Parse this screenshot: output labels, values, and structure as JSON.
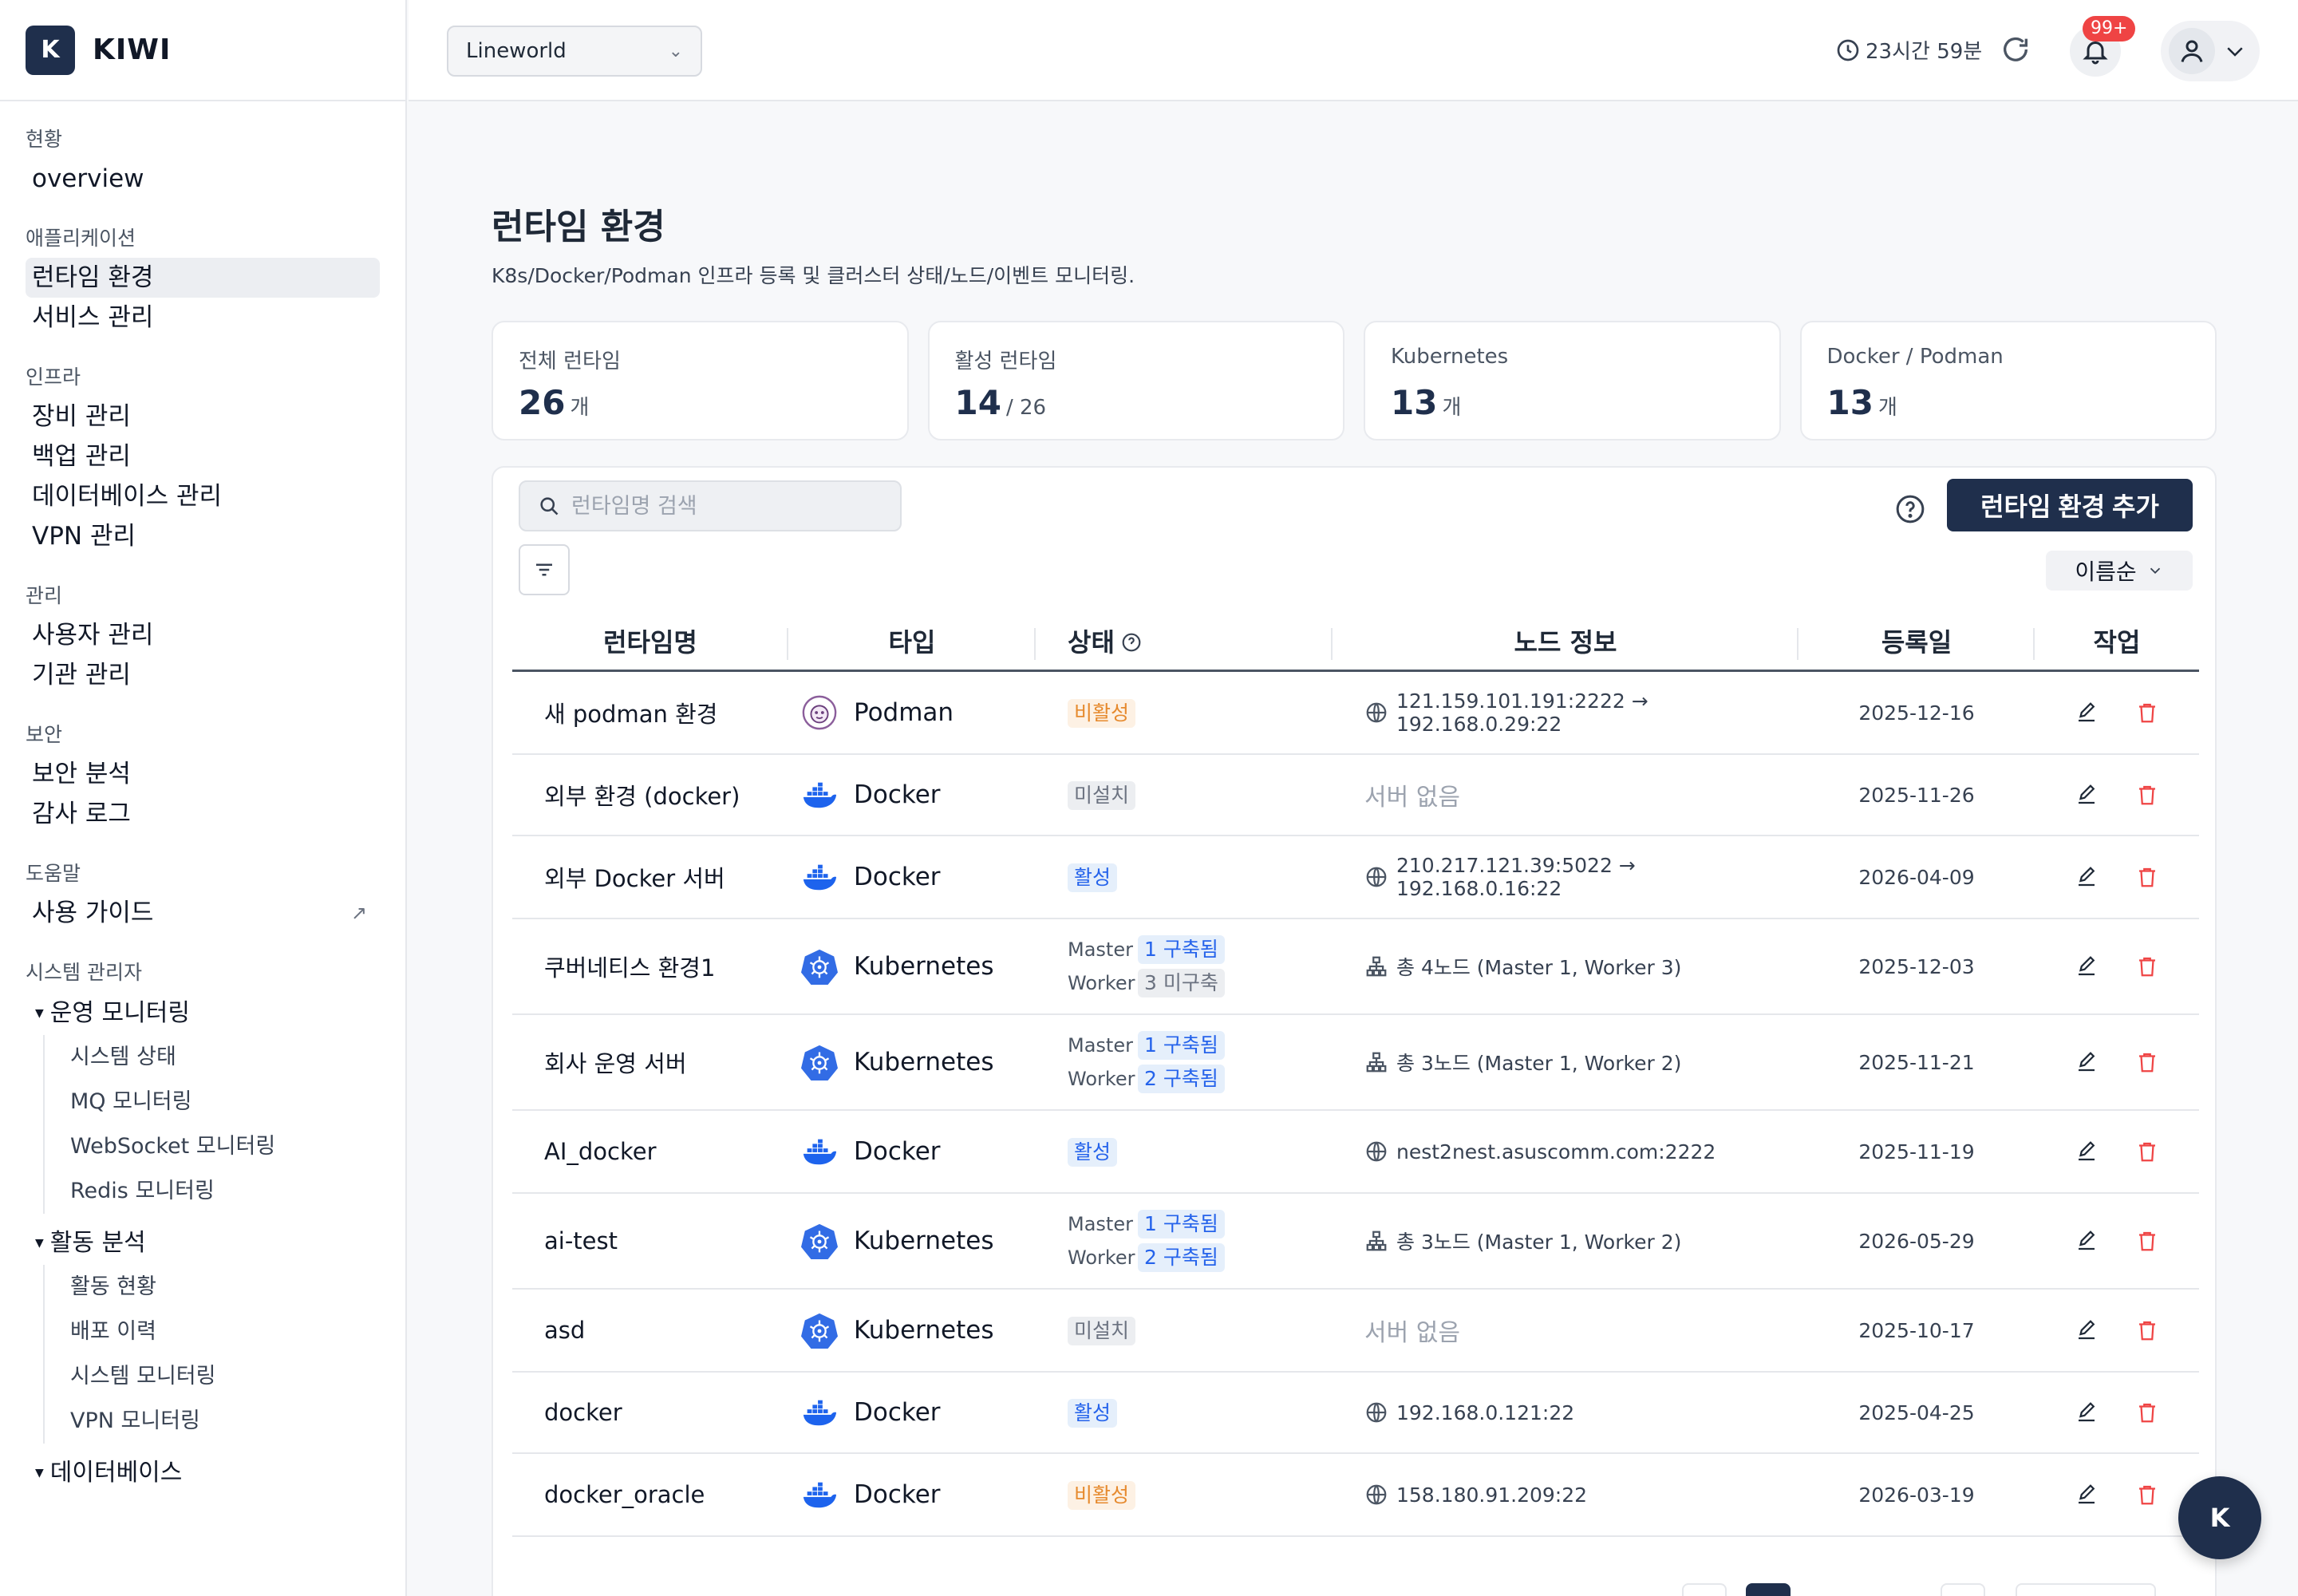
{
  "brand": {
    "logo_letter": "K",
    "name": "KIWI"
  },
  "sidebar": {
    "sections": [
      {
        "heading": "현황",
        "items": [
          {
            "label": "overview"
          }
        ]
      },
      {
        "heading": "애플리케이션",
        "items": [
          {
            "label": "런타임 환경",
            "active": true
          },
          {
            "label": "서비스 관리"
          }
        ]
      },
      {
        "heading": "인프라",
        "items": [
          {
            "label": "장비 관리"
          },
          {
            "label": "백업 관리"
          },
          {
            "label": "데이터베이스 관리"
          },
          {
            "label": "VPN 관리"
          }
        ]
      },
      {
        "heading": "관리",
        "items": [
          {
            "label": "사용자 관리"
          },
          {
            "label": "기관 관리"
          }
        ]
      },
      {
        "heading": "보안",
        "items": [
          {
            "label": "보안 분석"
          },
          {
            "label": "감사 로그"
          }
        ]
      },
      {
        "heading": "도움말",
        "items": [
          {
            "label": "사용 가이드",
            "external_icon": "↗"
          }
        ]
      }
    ],
    "admin": {
      "heading": "시스템 관리자",
      "groups": [
        {
          "title": "운영 모니터링",
          "items": [
            "시스템 상태",
            "MQ 모니터링",
            "WebSocket 모니터링",
            "Redis 모니터링"
          ]
        },
        {
          "title": "활동 분석",
          "items": [
            "활동 현황",
            "배포 이력",
            "시스템 모니터링",
            "VPN 모니터링"
          ]
        },
        {
          "title": "데이터베이스",
          "items": []
        }
      ]
    }
  },
  "header": {
    "org_select": "Lineworld",
    "session_timer": "23시간 59분",
    "notification_badge": "99+"
  },
  "page": {
    "title": "런타임 환경",
    "description": "K8s/Docker/Podman 인프라 등록 및 클러스터 상태/노드/이벤트 모니터링."
  },
  "cards": [
    {
      "label": "전체 런타임",
      "value": "26",
      "unit": "개"
    },
    {
      "label": "활성 런타임",
      "value": "14",
      "unit": "/ 26"
    },
    {
      "label": "Kubernetes",
      "value": "13",
      "unit": "개"
    },
    {
      "label": "Docker / Podman",
      "value": "13",
      "unit": "개"
    }
  ],
  "toolbar": {
    "search_placeholder": "런타임명 검색",
    "add_label": "런타임 환경 추가",
    "sort_label": "이름순"
  },
  "table": {
    "headers": [
      "런타임명",
      "타입",
      "상태",
      "노드 정보",
      "등록일",
      "작업"
    ],
    "rows": [
      {
        "name": "새 podman 환경",
        "type": "Podman",
        "status": "비활성",
        "status_kind": "inactive",
        "node_kind": "addr",
        "node": "121.159.101.191:2222 → 192.168.0.29:22",
        "date": "2025-12-16"
      },
      {
        "name": "외부 환경 (docker)",
        "type": "Docker",
        "status": "미설치",
        "status_kind": "uninstalled",
        "node_kind": "none",
        "node": "서버 없음",
        "date": "2025-11-26"
      },
      {
        "name": "외부 Docker 서버",
        "type": "Docker",
        "status": "활성",
        "status_kind": "active",
        "node_kind": "addr",
        "node": "210.217.121.39:5022 → 192.168.0.16:22",
        "date": "2026-04-09"
      },
      {
        "name": "쿠버네티스 환경1",
        "type": "Kubernetes",
        "status_kind": "k8s",
        "master": "1 구축됨",
        "master_kind": "built",
        "worker": "3 미구축",
        "worker_kind": "uninstalled",
        "node_kind": "cluster",
        "node": "총 4노드 (Master 1, Worker 3)",
        "date": "2025-12-03"
      },
      {
        "name": "회사 운영 서버",
        "type": "Kubernetes",
        "status_kind": "k8s",
        "master": "1 구축됨",
        "master_kind": "built",
        "worker": "2 구축됨",
        "worker_kind": "built",
        "node_kind": "cluster",
        "node": "총 3노드 (Master 1, Worker 2)",
        "date": "2025-11-21"
      },
      {
        "name": "AI_docker",
        "type": "Docker",
        "status": "활성",
        "status_kind": "active",
        "node_kind": "addr",
        "node": "nest2nest.asuscomm.com:2222",
        "date": "2025-11-19"
      },
      {
        "name": "ai-test",
        "type": "Kubernetes",
        "status_kind": "k8s",
        "master": "1 구축됨",
        "master_kind": "built",
        "worker": "2 구축됨",
        "worker_kind": "built",
        "node_kind": "cluster",
        "node": "총 3노드 (Master 1, Worker 2)",
        "date": "2026-05-29"
      },
      {
        "name": "asd",
        "type": "Kubernetes",
        "status": "미설치",
        "status_kind": "uninstalled",
        "node_kind": "none",
        "node": "서버 없음",
        "date": "2025-10-17"
      },
      {
        "name": "docker",
        "type": "Docker",
        "status": "활성",
        "status_kind": "active",
        "node_kind": "addr",
        "node": "192.168.0.121:22",
        "date": "2025-04-25"
      },
      {
        "name": "docker_oracle",
        "type": "Docker",
        "status": "비활성",
        "status_kind": "inactive",
        "node_kind": "addr",
        "node": "158.180.91.209:22",
        "date": "2026-03-19"
      }
    ],
    "master_label": "Master",
    "worker_label": "Worker"
  },
  "fab_label": "K",
  "colors": {
    "primary": "#1f2f4c",
    "active": "#2563eb",
    "inactive": "#e68a2e",
    "danger": "#ef4444",
    "docker": "#1d63ed",
    "kubernetes": "#326ce5"
  }
}
